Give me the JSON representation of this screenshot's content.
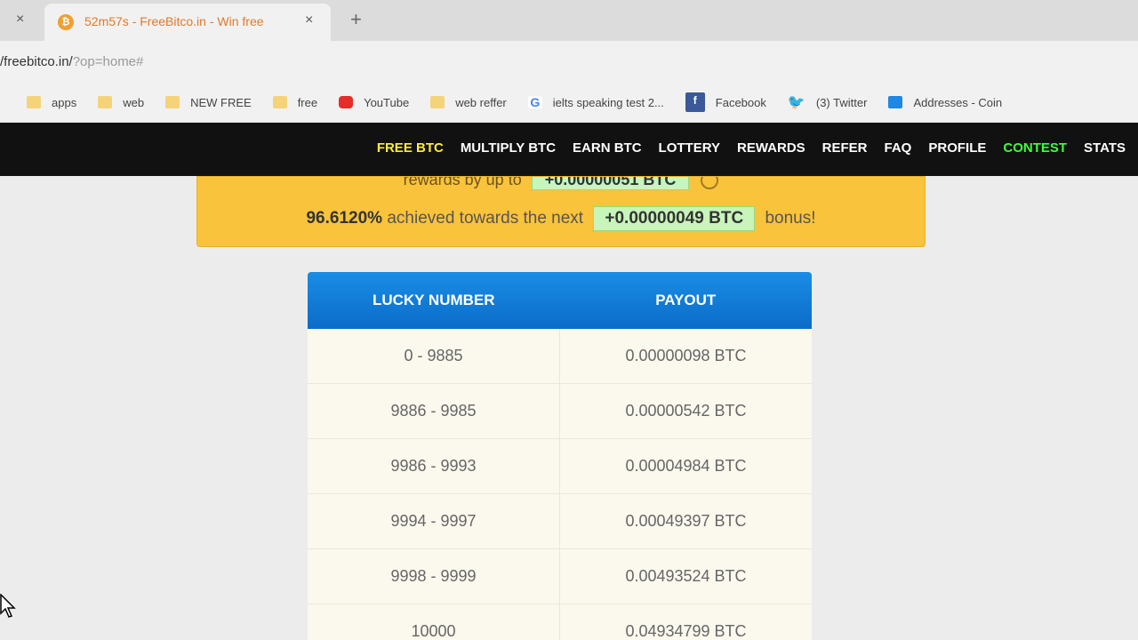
{
  "browser": {
    "tab": {
      "favicon": "₿",
      "title": "52m57s - FreeBitco.in - Win free",
      "close": "×"
    },
    "left_close": "×",
    "new_tab": "+",
    "url": {
      "host": "/freebitco.in/",
      "path": "?op=home#"
    },
    "bookmarks": [
      {
        "label": "apps",
        "icon": "folder-icon"
      },
      {
        "label": "web",
        "icon": "folder-icon"
      },
      {
        "label": "NEW FREE",
        "icon": "folder-icon"
      },
      {
        "label": "free",
        "icon": "folder-icon"
      },
      {
        "label": "YouTube",
        "icon": "youtube-icon"
      },
      {
        "label": "web reffer",
        "icon": "folder-icon"
      },
      {
        "label": "ielts speaking test 2...",
        "icon": "google-icon"
      },
      {
        "label": "Facebook",
        "icon": "facebook-icon"
      },
      {
        "label": "(3) Twitter",
        "icon": "twitter-icon"
      },
      {
        "label": "Addresses - Coin",
        "icon": "addresses-icon"
      }
    ]
  },
  "nav": {
    "items": [
      "FREE BTC",
      "MULTIPLY BTC",
      "EARN BTC",
      "LOTTERY",
      "REWARDS",
      "REFER",
      "FAQ",
      "PROFILE",
      "CONTEST",
      "STATS"
    ]
  },
  "banner": {
    "top_text": "rewards by up to",
    "top_value": "+0.00000051 BTC",
    "percent": "96.6120%",
    "middle_text": "achieved towards the next",
    "bonus_value": "+0.00000049 BTC",
    "end_text": "bonus!"
  },
  "payout_table": {
    "headers": [
      "LUCKY NUMBER",
      "PAYOUT"
    ],
    "rows": [
      [
        "0 - 9885",
        "0.00000098 BTC"
      ],
      [
        "9886 - 9985",
        "0.00000542 BTC"
      ],
      [
        "9986 - 9993",
        "0.00004984 BTC"
      ],
      [
        "9994 - 9997",
        "0.00049397 BTC"
      ],
      [
        "9998 - 9999",
        "0.00493524 BTC"
      ],
      [
        "10000",
        "0.04934799 BTC"
      ]
    ]
  },
  "colors": {
    "nav_active": "#ffec3d",
    "nav_contest": "#3dff3d",
    "banner_bg": "#f9c33b",
    "table_header": "#0b6cc8"
  }
}
